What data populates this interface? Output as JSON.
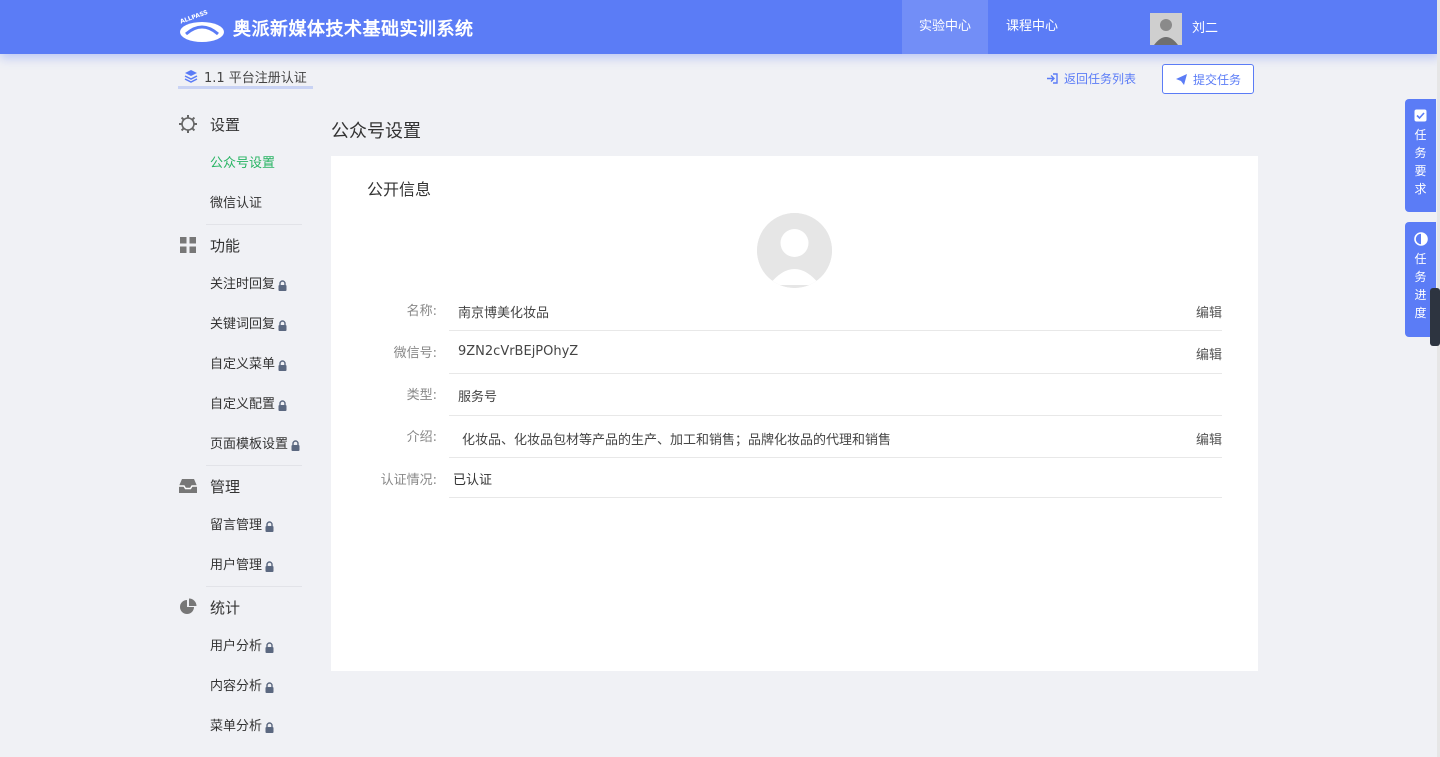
{
  "header": {
    "app_title": "奥派新媒体技术基础实训系统",
    "logo_text": "ALLPASS",
    "nav": [
      "实验中心",
      "课程中心"
    ],
    "user_name": "刘二"
  },
  "subbar": {
    "breadcrumb": "1.1 平台注册认证",
    "back_label": "返回任务列表",
    "submit_label": "提交任务"
  },
  "sidebar": {
    "sections": [
      {
        "title": "设置",
        "icon": "gear-icon",
        "items": [
          {
            "label": "公众号设置",
            "locked": false,
            "active": true
          },
          {
            "label": "微信认证",
            "locked": false
          }
        ]
      },
      {
        "title": "功能",
        "icon": "grid-icon",
        "items": [
          {
            "label": "关注时回复",
            "locked": true
          },
          {
            "label": "关键词回复",
            "locked": true
          },
          {
            "label": "自定义菜单",
            "locked": true
          },
          {
            "label": "自定义配置",
            "locked": true
          },
          {
            "label": "页面模板设置",
            "locked": true
          }
        ]
      },
      {
        "title": "管理",
        "icon": "inbox-icon",
        "items": [
          {
            "label": "留言管理",
            "locked": true
          },
          {
            "label": "用户管理",
            "locked": true
          }
        ]
      },
      {
        "title": "统计",
        "icon": "pie-chart-icon",
        "items": [
          {
            "label": "用户分析",
            "locked": true
          },
          {
            "label": "内容分析",
            "locked": true
          },
          {
            "label": "菜单分析",
            "locked": true
          }
        ]
      }
    ]
  },
  "main": {
    "page_title": "公众号设置",
    "card_title": "公开信息",
    "fields": [
      {
        "label": "名称:",
        "value": "南京博美化妆品",
        "edit": "编辑"
      },
      {
        "label": "微信号:",
        "value": "9ZN2cVrBEjPOhyZ",
        "edit": "编辑"
      },
      {
        "label": "类型:",
        "value": "服务号",
        "edit": ""
      },
      {
        "label": "介绍:",
        "value": "化妆品、化妆品包材等产品的生产、加工和销售；品牌化妆品的代理和销售",
        "edit": "编辑"
      },
      {
        "label": "认证情况:",
        "value": "已认证",
        "edit": ""
      }
    ]
  },
  "right_tabs": [
    {
      "chars": [
        "任",
        "务",
        "要",
        "求"
      ],
      "icon": "checkbox-icon"
    },
    {
      "chars": [
        "任",
        "务",
        "进",
        "度"
      ],
      "icon": "progress-icon"
    }
  ],
  "colors": {
    "primary": "#5b7cf6",
    "active_green": "#28b463",
    "background": "#f0f1f5"
  }
}
